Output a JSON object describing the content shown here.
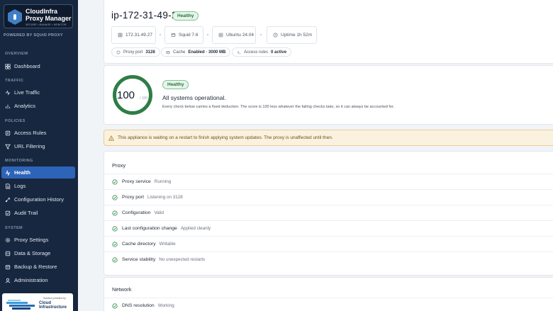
{
  "brand": {
    "line1": "CloudInfra",
    "line2": "Proxy Manager",
    "tagline": "SECURE • MANAGE • MONITOR",
    "powered_by": "POWERED BY SQUID PROXY"
  },
  "sidebar": {
    "sections": [
      {
        "label": "OVERVIEW",
        "items": [
          {
            "label": "Dashboard",
            "icon": "grid-icon"
          }
        ]
      },
      {
        "label": "TRAFFIC",
        "items": [
          {
            "label": "Live Traffic",
            "icon": "activity-icon"
          },
          {
            "label": "Analytics",
            "icon": "bar-chart-icon"
          }
        ]
      },
      {
        "label": "POLICIES",
        "items": [
          {
            "label": "Access Rules",
            "icon": "rules-icon"
          },
          {
            "label": "URL Filtering",
            "icon": "filter-icon"
          }
        ]
      },
      {
        "label": "MONITORING",
        "items": [
          {
            "label": "Health",
            "icon": "pulse-icon",
            "active": true
          },
          {
            "label": "Logs",
            "icon": "document-icon"
          },
          {
            "label": "Configuration History",
            "icon": "history-icon"
          },
          {
            "label": "Audit Trail",
            "icon": "audit-icon"
          }
        ]
      },
      {
        "label": "SYSTEM",
        "items": [
          {
            "label": "Proxy Settings",
            "icon": "gear-icon"
          },
          {
            "label": "Data & Storage",
            "icon": "database-icon"
          },
          {
            "label": "Backup & Restore",
            "icon": "backup-icon"
          },
          {
            "label": "Administration",
            "icon": "user-icon"
          }
        ]
      }
    ],
    "partner": {
      "provided_by": "Solution provided by",
      "name_line1": "Cloud",
      "name_line2": "Infrastructure"
    }
  },
  "header": {
    "hostname": "ip-172-31-49-27",
    "status_badge": "Healthy",
    "info": [
      {
        "icon": "network-icon",
        "text": "172.31.49.27"
      },
      {
        "icon": "server-icon",
        "text": "Squid 7.6"
      },
      {
        "icon": "os-icon",
        "text": "Ubuntu 24.04"
      },
      {
        "icon": "clock-icon",
        "text": "Uptime 1h 52m"
      }
    ],
    "pills": [
      {
        "icon": "port-icon",
        "label": "Proxy port",
        "value": "3128"
      },
      {
        "icon": "cache-icon",
        "label": "Cache",
        "value": "Enabled · 3000 MB"
      },
      {
        "icon": "rules-icon",
        "label": "Access rules",
        "value": "0 active"
      }
    ]
  },
  "score": {
    "value": "100",
    "max": "/ 100",
    "fraction": 1.0,
    "badge": "Healthy",
    "summary": "All systems operational.",
    "explanation": "Every check below carries a fixed deduction. The score is 100 less whatever the failing checks take, so it can always be accounted for."
  },
  "alert": {
    "text": "This appliance is waiting on a restart to finish applying system updates. The proxy is unaffected until then."
  },
  "groups": [
    {
      "title": "Proxy",
      "checks": [
        {
          "name": "Proxy service",
          "value": "Running"
        },
        {
          "name": "Proxy port",
          "value": "Listening on 3128"
        },
        {
          "name": "Configuration",
          "value": "Valid"
        },
        {
          "name": "Last configuration change",
          "value": "Applied cleanly"
        },
        {
          "name": "Cache directory",
          "value": "Writable"
        },
        {
          "name": "Service stability",
          "value": "No unexpected restarts"
        }
      ]
    },
    {
      "title": "Network",
      "checks": [
        {
          "name": "DNS resolution",
          "value": "Working"
        }
      ]
    }
  ],
  "colors": {
    "sidebar_bg": "#17273f",
    "active_nav": "#2d64b8",
    "healthy_green": "#2e7d46",
    "alert_bg": "#fbf1df"
  }
}
